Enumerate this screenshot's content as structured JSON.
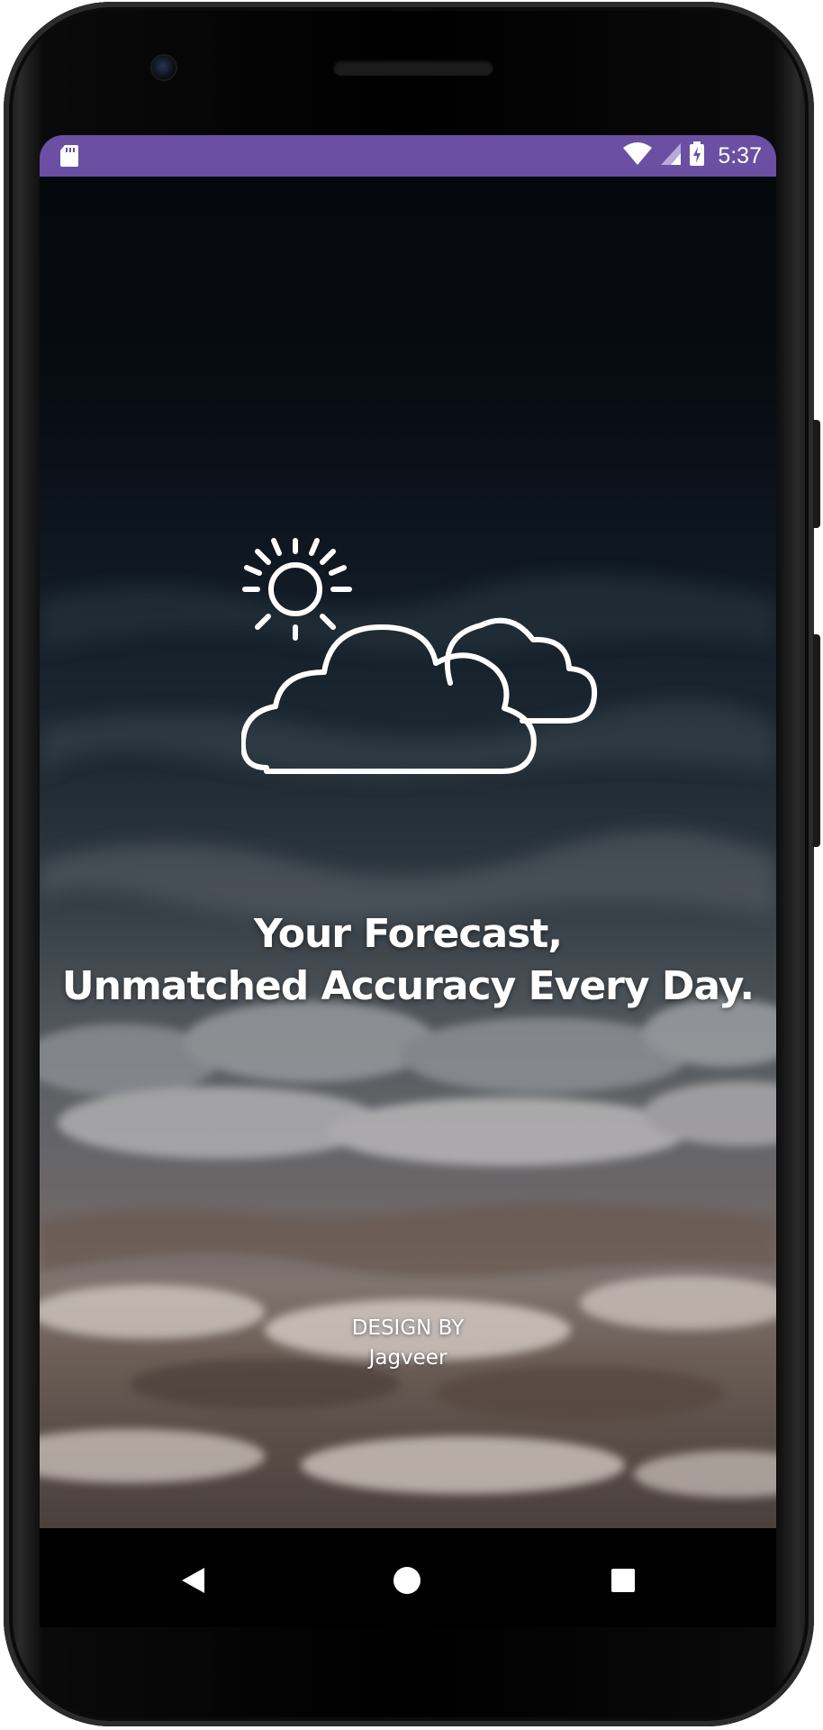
{
  "status_bar": {
    "time": "5:37",
    "background_color": "#6a4fa3",
    "icons": [
      "sd-card-icon",
      "wifi-icon",
      "cellular-signal-icon",
      "battery-charging-icon"
    ]
  },
  "splash": {
    "logo_icon": "partly-cloudy-icon",
    "tagline_line1": "Your Forecast,",
    "tagline_line2": "Unmatched Accuracy Every Day.",
    "credit_line1": "DESIGN BY",
    "credit_line2": "Jagveer"
  },
  "nav_bar": {
    "icons": [
      "back-triangle-icon",
      "home-circle-icon",
      "recents-square-icon"
    ]
  }
}
